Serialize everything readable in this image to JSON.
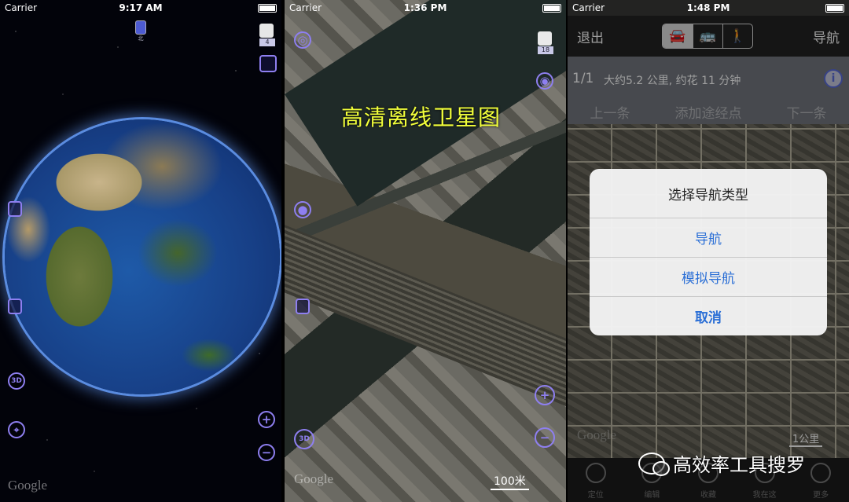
{
  "screen1": {
    "status": {
      "carrier": "Carrier",
      "time": "9:17 AM"
    },
    "layer_badge": "4",
    "compass_label": "北",
    "logo": "Google"
  },
  "screen2": {
    "status": {
      "carrier": "Carrier",
      "time": "1:36 PM"
    },
    "layer_badge": "18",
    "overlay_title": "高清离线卫星图",
    "scale": "100米",
    "logo": "Google",
    "mode_3d": "3D"
  },
  "screen3": {
    "status": {
      "carrier": "Carrier",
      "time": "1:48 PM"
    },
    "nav": {
      "exit_label": "退出",
      "go_label": "导航",
      "modes": [
        "car-icon",
        "bus-icon",
        "walk-icon"
      ],
      "mode_glyphs": [
        "🚘",
        "🚌",
        "🚶"
      ]
    },
    "route": {
      "page": "1/1",
      "description": "大约5.2 公里, 约花 11 分钟",
      "prev": "上一条",
      "add_waypoint": "添加途经点",
      "next": "下一条"
    },
    "dialog": {
      "title": "选择导航类型",
      "options": [
        "导航",
        "模拟导航"
      ],
      "cancel": "取消"
    },
    "scale": "1公里",
    "logo": "Google",
    "tabs": [
      "定位",
      "编辑",
      "收藏",
      "我在这",
      "更多"
    ]
  },
  "watermark": "高效率工具搜罗",
  "colors": {
    "accent": "#8e7ff0",
    "link": "#2b6fd6",
    "title_yellow": "#f2ff3a"
  }
}
